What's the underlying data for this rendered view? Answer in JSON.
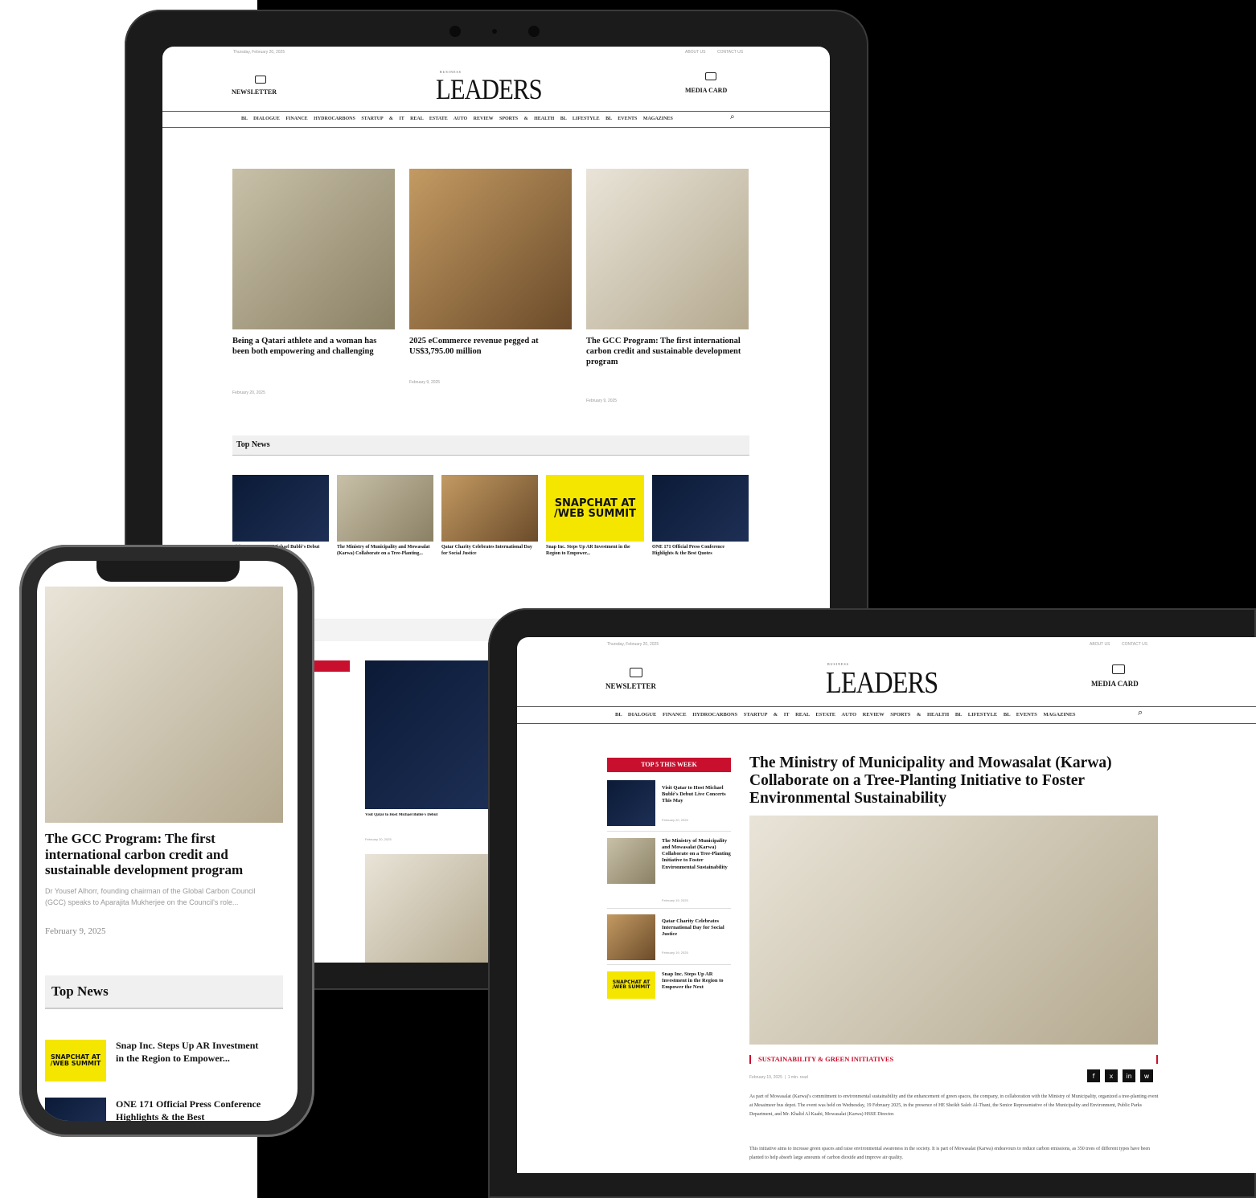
{
  "site": {
    "brand_small": "BUSINESS",
    "brand": "LEADERS",
    "date": "Thursday, February 20, 2025",
    "top_links": [
      "ABOUT US",
      "CONTACT US"
    ],
    "newsletter": "NEWSLETTER",
    "media_card": "MEDIA CARD",
    "nav": "BL DIALOGUE FINANCE HYDROCARBONS STARTUP & IT REAL ESTATE AUTO REVIEW SPORTS & HEALTH BL LIFESTYLE BL EVENTS MAGAZINES"
  },
  "tablet_large": {
    "articles": [
      {
        "title": "Being a Qatari athlete and a woman has been both empowering and challenging",
        "date": "February 20, 2025"
      },
      {
        "title": "2025 eCommerce revenue pegged at US$3,795.00 million",
        "date": "February 9, 2025"
      },
      {
        "title": "The GCC Program: The first international carbon credit and sustainable development program",
        "date": "February 9, 2025"
      }
    ],
    "top_news_label": "Top News",
    "top_news": [
      {
        "title": "Visit Qatar to Host Michael Bublé's Debut Live Concerts"
      },
      {
        "title": "The Ministry of Municipality and Mowasalat (Karwa) Collaborate on a Tree-Planting..."
      },
      {
        "title": "Qatar Charity Celebrates International Day for Social Justice"
      },
      {
        "title": "Snap Inc. Steps Up AR Investment in the Region to Empower..."
      },
      {
        "title": "ONE 171 Official Press Conference Highlights & the Best Quotes"
      }
    ],
    "snap_logo": "SNAPCHAT AT\n/WEB SUMMIT",
    "lower_caption": "Visit Qatar to Host Michael Bublé's Debut",
    "lower_date": "February 20, 2025"
  },
  "phone": {
    "headline": "The GCC Program: The first international carbon credit and sustainable development program",
    "excerpt": "Dr Yousef Alhorr, founding chairman of the Global Carbon Council (GCC) speaks to Aparajita Mukherjee on the Council's role...",
    "date": "February 9, 2025",
    "top_news_label": "Top News",
    "items": [
      {
        "title": "Snap Inc. Steps Up AR Investment in the Region to Empower..."
      },
      {
        "title": "ONE 171 Official Press Conference Highlights & the Best"
      }
    ],
    "snap_logo": "SNAPCHAT AT\n/WEB SUMMIT"
  },
  "tablet_small": {
    "sidebar_label": "TOP 5 THIS WEEK",
    "sidebar_items": [
      {
        "title": "Visit Qatar to Host Michael Bublé's Debut Live Concerts This May",
        "date": "February 20, 2025"
      },
      {
        "title": "The Ministry of Municipality and Mowasalat (Karwa) Collaborate on a Tree-Planting Initiative to Foster Environmental Sustainability",
        "date": "February 19, 2025"
      },
      {
        "title": "Qatar Charity Celebrates International Day for Social Justice",
        "date": "February 19, 2025"
      },
      {
        "title": "Snap Inc. Steps Up AR Investment in the Region to Empower the Next",
        "date": ""
      }
    ],
    "headline": "The Ministry of Municipality and Mowasalat (Karwa) Collaborate on a Tree-Planting Initiative to Foster Environmental Sustainability",
    "category": "SUSTAINABILITY & GREEN INITIATIVES",
    "meta": "February 19, 2025  |  1 min. read",
    "share": [
      "f",
      "x",
      "in",
      "w"
    ],
    "para1": "As part of Mowasalat (Karwa)'s commitment to environmental sustainability and the enhancement of green spaces, the company, in collaboration with the Ministry of Municipality, organized a tree-planting event at Mesaimeer bus depot. The event was held on Wednesday, 19 February 2025, in the presence of HE Sheikh Saleh Al-Thani, the Senior Representative of the Municipality and Environment, Public Parks Department, and Mr. Khalid Al Kaabi, Mowasalat (Karwa) HSSE Director.",
    "para2": "This initiative aims to increase green spaces and raise environmental awareness in the society. It is part of Mowasalat (Karwa) endeavours to reduce carbon emissions, as 350 trees of different types have been planted to help absorb large amounts of carbon dioxide and improve air quality."
  },
  "colors": {
    "accent_red": "#c8102e",
    "snap_yellow": "#f5e600",
    "frame": "#1b1b1b"
  }
}
